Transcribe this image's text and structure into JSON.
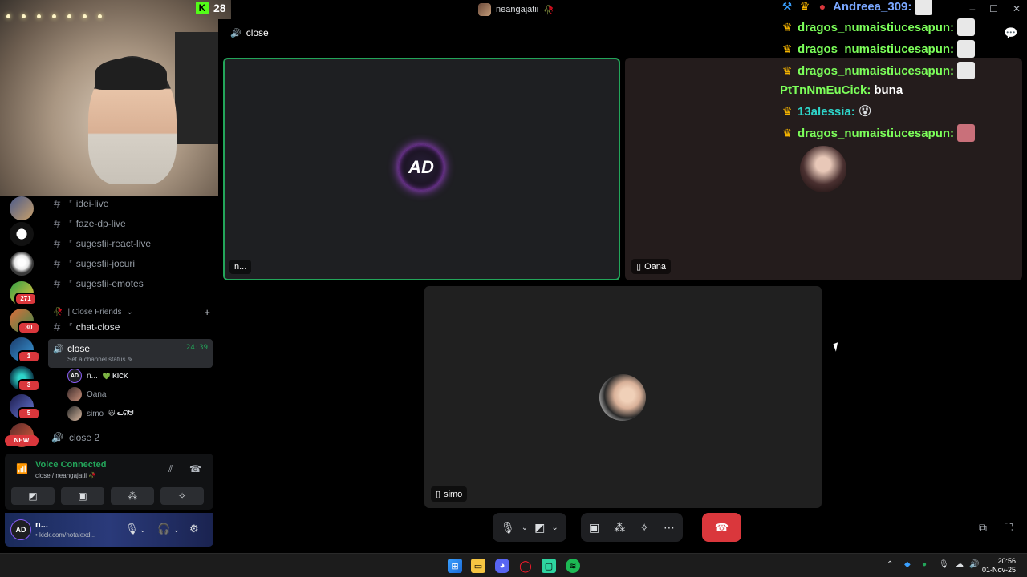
{
  "window": {
    "title": "neangajatii",
    "title_suffix": "🥀"
  },
  "kick_overlay": {
    "viewer_count": "28"
  },
  "channels": [
    {
      "label": "idei-live"
    },
    {
      "label": "faze-dp-live"
    },
    {
      "label": "sugestii-react-live"
    },
    {
      "label": "sugestii-jocuri"
    },
    {
      "label": "sugestii-emotes"
    }
  ],
  "category": {
    "label": "| Close Friends"
  },
  "chat_close": {
    "label": "chat-close"
  },
  "voice_channel": {
    "name": "close",
    "status_placeholder": "Set a channel status",
    "timer": "24:39"
  },
  "voice_members": [
    {
      "name": "n...",
      "tag": "💚 KICK"
    },
    {
      "name": "Oana",
      "tag": ""
    },
    {
      "name": "simo",
      "tag": "🐱 ᓚᘏᗢ"
    }
  ],
  "voice_channel_2": {
    "name": "close 2"
  },
  "server_badges": {
    "b1": "271",
    "b2": "30",
    "b3": "1",
    "b4": "3",
    "b5": "5",
    "new": "NEW"
  },
  "voice_connected": {
    "title": "Voice Connected",
    "subtitle": "close / neangajatii 🥀"
  },
  "user": {
    "name": "n...",
    "status": "• kick.com/notalexd..."
  },
  "call": {
    "header": "close",
    "tiles": [
      {
        "label": "n..."
      },
      {
        "label": "Oana"
      },
      {
        "label": "simo"
      }
    ]
  },
  "chat": [
    {
      "user": "Andreea_309:",
      "user_color": "#7aa7ff",
      "text": ""
    },
    {
      "user": "dragos_numaistiucesapun:",
      "user_color": "#7cff5a",
      "text": ""
    },
    {
      "user": "dragos_numaistiucesapun:",
      "user_color": "#7cff5a",
      "text": ""
    },
    {
      "user": "dragos_numaistiucesapun:",
      "user_color": "#7cff5a",
      "text": ""
    },
    {
      "user": "PtTnNmEuCick:",
      "user_color": "#7cff5a",
      "text": "buna"
    },
    {
      "user": "13alessia:",
      "user_color": "#2ed4c9",
      "text": ""
    },
    {
      "user": "dragos_numaistiucesapun:",
      "user_color": "#7cff5a",
      "text": ""
    }
  ],
  "taskbar": {
    "time": "20:56",
    "date": "01-Nov-25"
  },
  "colors": {
    "accent_green": "#23a55a",
    "danger": "#da373c",
    "tile_bg": "#1e1f22",
    "kick_green": "#53fc18"
  }
}
